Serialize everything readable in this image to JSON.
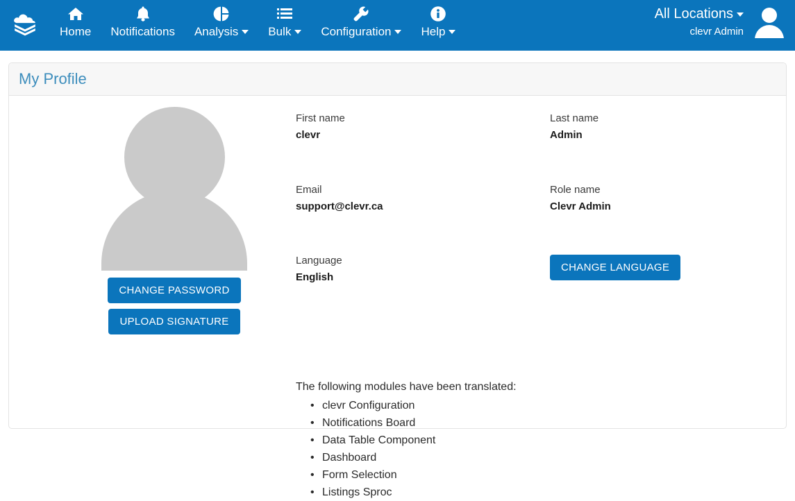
{
  "navbar": {
    "brand_icon": "cloud-layers-logo",
    "items": [
      {
        "label": "Home",
        "icon": "home-icon",
        "has_caret": false
      },
      {
        "label": "Notifications",
        "icon": "bell-icon",
        "has_caret": false
      },
      {
        "label": "Analysis",
        "icon": "pie-chart-icon",
        "has_caret": true
      },
      {
        "label": "Bulk",
        "icon": "list-icon",
        "has_caret": true
      },
      {
        "label": "Configuration",
        "icon": "wrench-icon",
        "has_caret": true
      },
      {
        "label": "Help",
        "icon": "info-circle-icon",
        "has_caret": true
      }
    ],
    "locations_label": "All Locations",
    "username": "clevr Admin",
    "avatar_icon": "user-avatar-icon",
    "background_color": "#0b75bc"
  },
  "card": {
    "title": "My Profile"
  },
  "profile": {
    "picture_icon": "user-placeholder-icon",
    "change_password_label": "CHANGE PASSWORD",
    "upload_signature_label": "UPLOAD SIGNATURE",
    "change_language_label": "CHANGE LANGUAGE",
    "fields": {
      "first_name_label": "First name",
      "first_name_value": "clevr",
      "last_name_label": "Last name",
      "last_name_value": "Admin",
      "email_label": "Email",
      "email_value": "support@clevr.ca",
      "role_name_label": "Role name",
      "role_name_value": "Clevr Admin",
      "language_label": "Language",
      "language_value": "English"
    },
    "modules_intro": "The following modules have been translated:",
    "modules": [
      "clevr Configuration",
      "Notifications Board",
      "Data Table Component",
      "Dashboard",
      "Form Selection",
      "Listings Sproc"
    ]
  },
  "colors": {
    "primary": "#0b75bc",
    "title": "#3c8dbc",
    "placeholder_gray": "#cacaca"
  }
}
